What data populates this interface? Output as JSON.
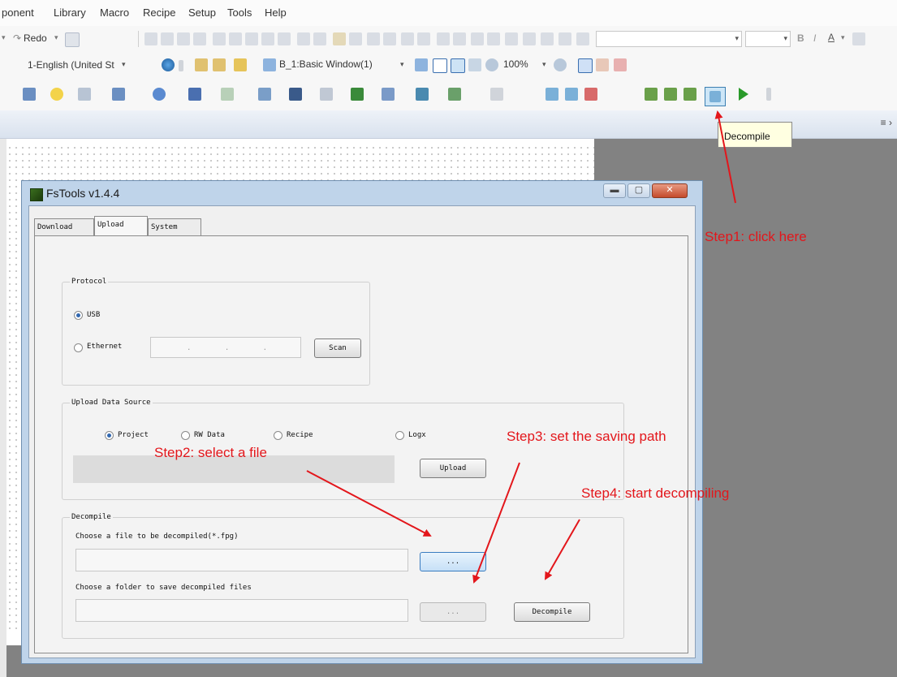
{
  "menubar": {
    "items": [
      "ponent",
      "Library",
      "Macro",
      "Recipe",
      "Setup",
      "Tools",
      "Help"
    ]
  },
  "toolbar": {
    "redo_label": "Redo",
    "language_select": "1-English (United St",
    "window_select": "B_1:Basic Window(1)",
    "zoom_label": "100%",
    "decompile_tooltip": "Decompile"
  },
  "dialog": {
    "title": "FsTools v1.4.4",
    "tabs": [
      "Download",
      "Upload",
      "System"
    ],
    "active_tab": "Upload",
    "protocol": {
      "label": "Protocol",
      "usb_label": "USB",
      "ethernet_label": "Ethernet",
      "ip_value": ". . .",
      "scan_button": "Scan"
    },
    "upload_source": {
      "label": "Upload Data Source",
      "options": [
        "Project",
        "RW Data",
        "Recipe",
        "Logx"
      ],
      "selected": "Project",
      "upload_button": "Upload"
    },
    "decompile": {
      "label": "Decompile",
      "file_prompt": "Choose a file to be decompiled(*.fpg)",
      "folder_prompt": "Choose a folder to save decompiled files",
      "browse_label": "...",
      "decompile_button": "Decompile"
    }
  },
  "annotations": {
    "step1": "Step1: click here",
    "step2": "Step2: select a file",
    "step3": "Step3: set the saving path",
    "step4": "Step4: start decompiling",
    "color": "#e3161b"
  }
}
